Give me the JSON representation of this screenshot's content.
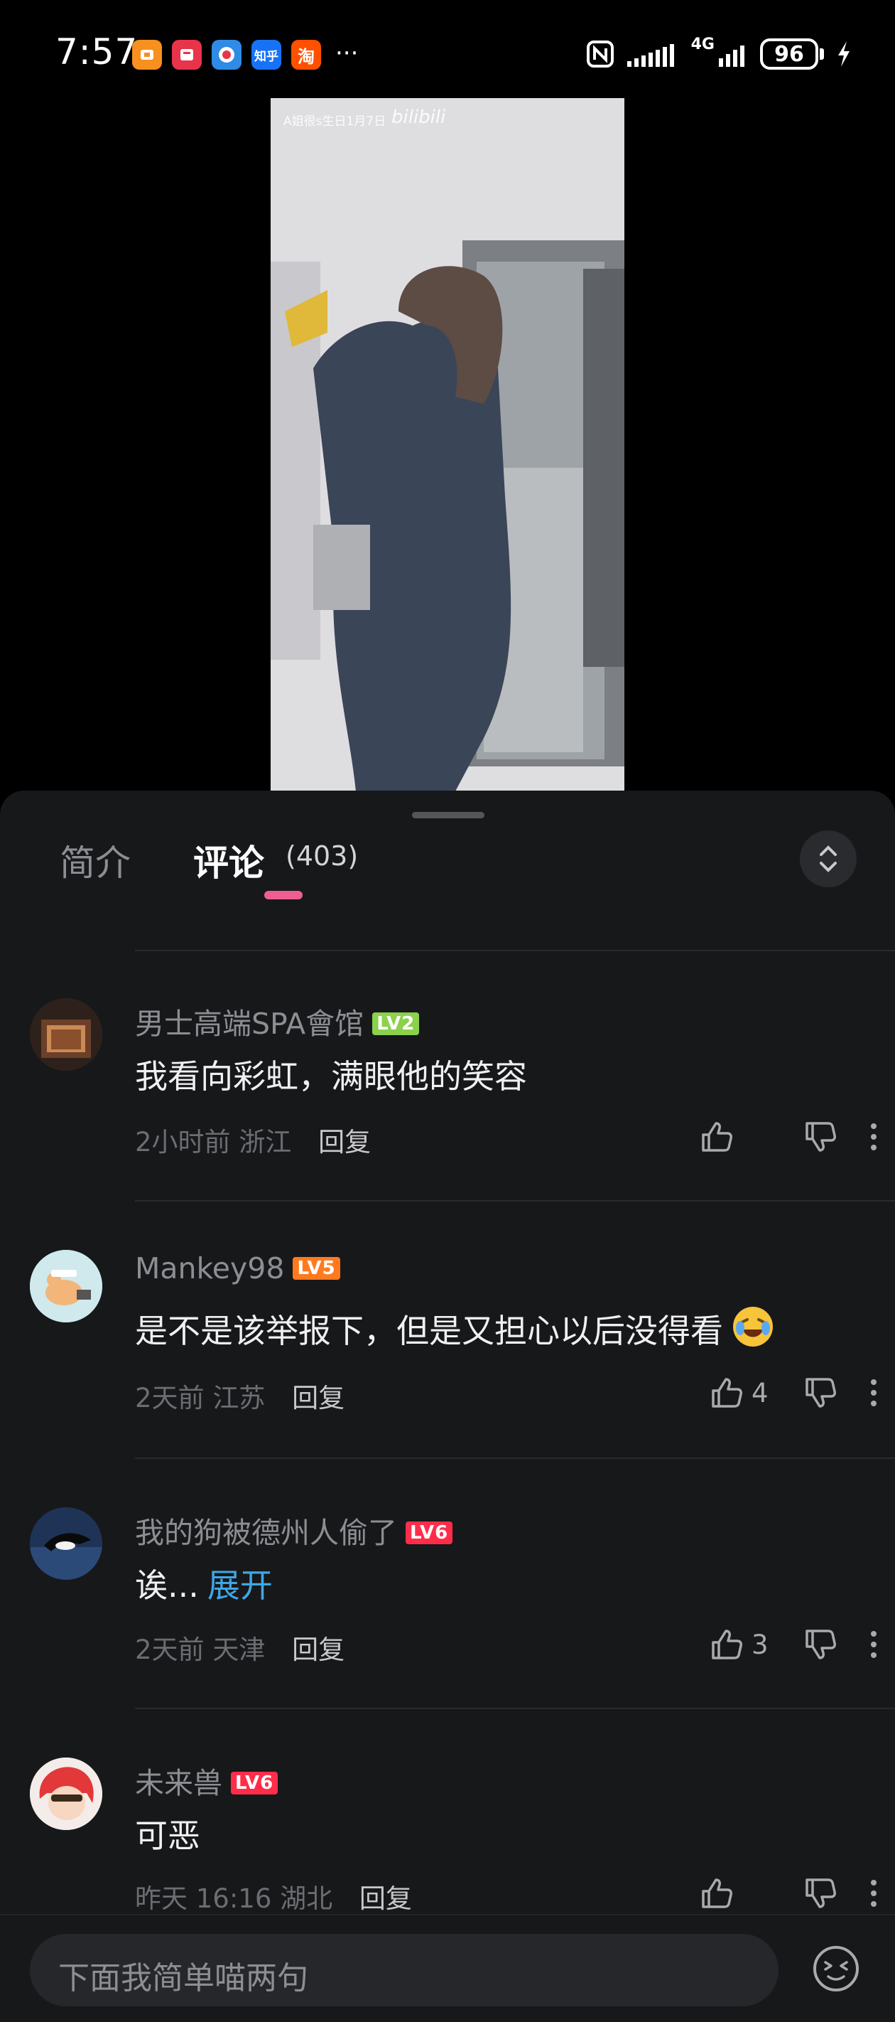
{
  "status_bar": {
    "time": "7:57",
    "apps": [
      {
        "name": "app-ico-1",
        "glyph": "",
        "color": "#f7901e"
      },
      {
        "name": "app-ico-2",
        "glyph": "",
        "color": "#e8344a"
      },
      {
        "name": "app-ico-3",
        "glyph": "",
        "color": "#2f8be6"
      },
      {
        "name": "app-ico-zhihu",
        "glyph": "知乎",
        "color": "#1772f6"
      },
      {
        "name": "app-ico-taobao",
        "glyph": "淘",
        "color": "#ff5000"
      }
    ],
    "more": "···",
    "network": "4G",
    "battery": "96"
  },
  "video": {
    "watermark": "A姐很s生日1月7日",
    "logo": "bilibili"
  },
  "tabs": {
    "intro": "简介",
    "comments": "评论",
    "comment_count": "(403)"
  },
  "comments": [
    {
      "username": "男士高端SPA會馆",
      "level": "LV2",
      "text": "我看向彩虹，满眼他的笑容",
      "time": "2小时前",
      "location": "浙江",
      "reply": "回复",
      "likes": ""
    },
    {
      "username": "Mankey98",
      "level": "LV5",
      "text": "是不是该举报下，但是又担心以后没得看",
      "time": "2天前",
      "location": "江苏",
      "reply": "回复",
      "likes": "4"
    },
    {
      "username": "我的狗被德州人偷了",
      "level": "LV6",
      "text": "诶...",
      "expand": "展开",
      "time": "2天前",
      "location": "天津",
      "reply": "回复",
      "likes": "3"
    },
    {
      "username": "未来兽",
      "level": "LV6",
      "text": "可恶",
      "time": "昨天 16:16",
      "location": "湖北",
      "reply": "回复",
      "likes": ""
    }
  ],
  "input": {
    "placeholder": "下面我简单喵两句"
  },
  "colors": {
    "accent": "#ee5f8f",
    "link": "#3fa7e6",
    "sheet_bg": "#17181a"
  }
}
